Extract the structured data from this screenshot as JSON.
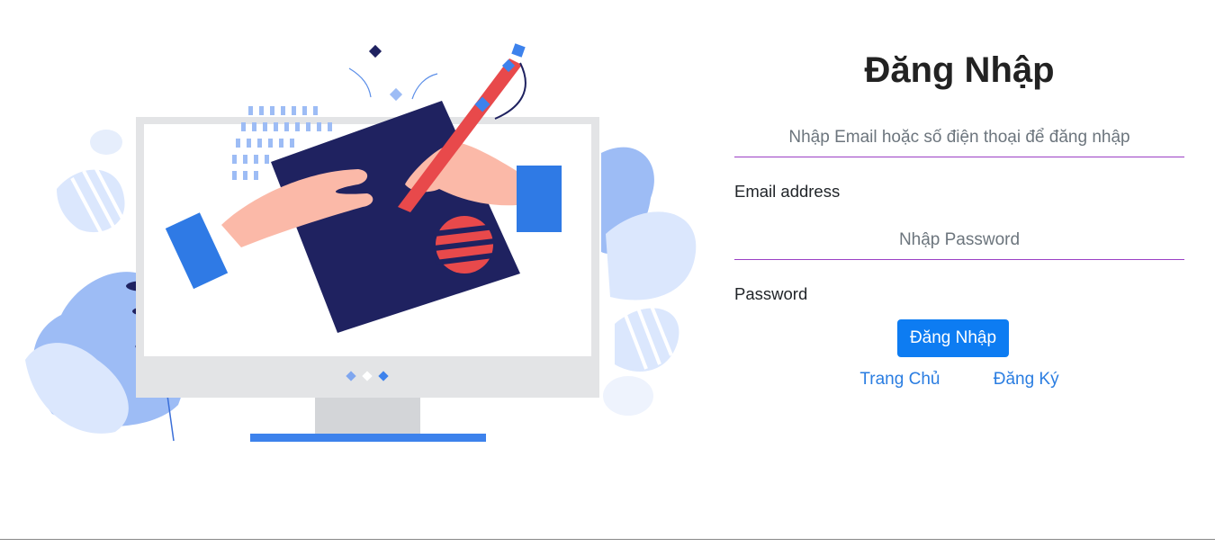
{
  "login": {
    "title": "Đăng Nhập",
    "email": {
      "placeholder": "Nhập Email hoặc số điện thoại để đăng nhập",
      "label": "Email address"
    },
    "password": {
      "placeholder": "Nhập Password",
      "label": "Password"
    },
    "submit_label": "Đăng Nhập",
    "links": {
      "home": "Trang Chủ",
      "register": "Đăng Ký"
    }
  },
  "colors": {
    "accent_button": "#0d7cf2",
    "link": "#2a7de1",
    "field_underline": "#9b3fc5"
  }
}
